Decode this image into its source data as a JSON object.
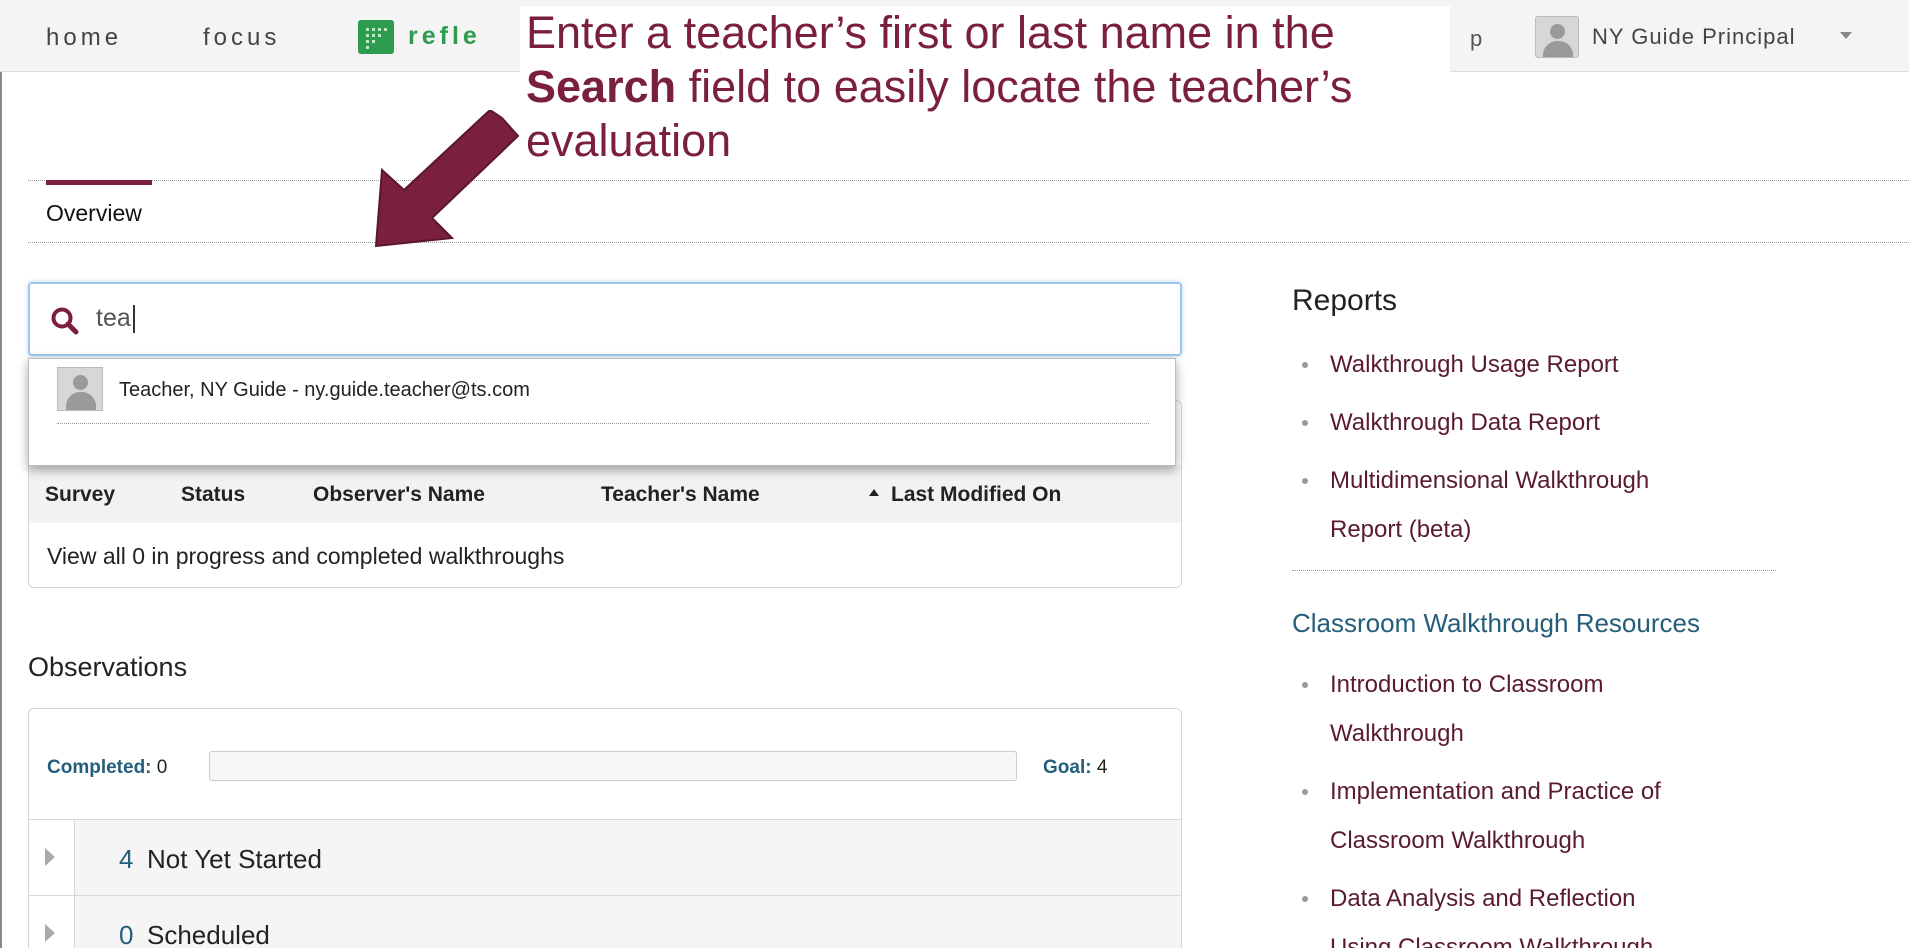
{
  "nav": {
    "home": "home",
    "focus": "focus",
    "brand": "refle",
    "help_fragment": "p",
    "user": "NY Guide Principal"
  },
  "callout": {
    "part1": "Enter a teacher’s first or last name in the ",
    "bold": "Search",
    "part2": " field to easily locate the teacher’s evaluation"
  },
  "tabs": {
    "overview": "Overview"
  },
  "search": {
    "value": "tea"
  },
  "dropdown": {
    "result": "Teacher, NY Guide - ny.guide.teacher@ts.com"
  },
  "walkthroughs": {
    "columns": [
      "Survey",
      "Status",
      "Observer's Name",
      "Teacher's Name",
      "Last Modified On"
    ],
    "view_all": "View all 0 in progress and completed walkthroughs"
  },
  "observations": {
    "title": "Observations",
    "completed_label": "Completed:",
    "completed_value": "0",
    "goal_label": "Goal:",
    "goal_value": "4",
    "progress_fraction": 0,
    "rows": [
      {
        "count": "4",
        "label": "Not Yet Started"
      },
      {
        "count": "0",
        "label": "Scheduled"
      }
    ]
  },
  "reports": {
    "title": "Reports",
    "items": [
      "Walkthrough Usage Report",
      "Walkthrough Data Report",
      "Multidimensional Walkthrough",
      "Report (beta)"
    ]
  },
  "resources": {
    "title": "Classroom Walkthrough Resources",
    "items": [
      "Introduction to Classroom",
      "Walkthrough",
      "Implementation and Practice of",
      "Classroom Walkthrough",
      "Data Analysis and Reflection",
      "Using Classroom Walkthrough"
    ]
  },
  "colors": {
    "accent": "#7a1f3d",
    "link_blue": "#245e7a",
    "brand_green": "#2e9c4f"
  }
}
